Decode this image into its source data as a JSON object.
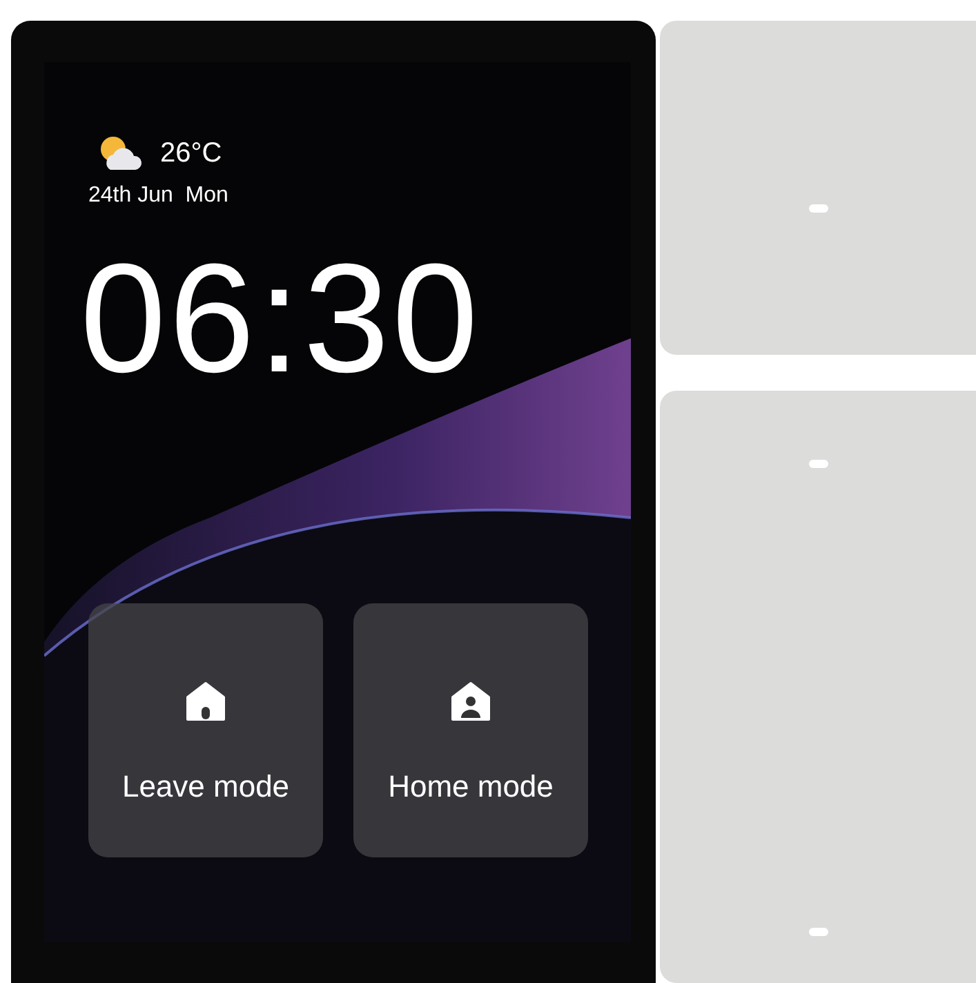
{
  "weather": {
    "temperature": "26°C",
    "date": "24th Jun  Mon"
  },
  "clock": {
    "time": "06:30"
  },
  "modes": [
    {
      "label": "Leave mode",
      "kind": "leave"
    },
    {
      "label": "Home mode",
      "kind": "home"
    }
  ]
}
